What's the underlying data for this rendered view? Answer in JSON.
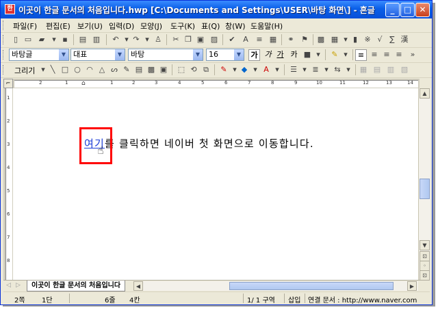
{
  "window": {
    "title": "이곳이 한글 문서의 처음입니다.hwp [C:\\Documents and Settings\\USER\\바탕 화면\\] - 흔글",
    "app_icon": "hwp-app-icon",
    "minimize": "_",
    "maximize": "□",
    "close": "✕"
  },
  "menu": [
    "파일(F)",
    "편집(E)",
    "보기(U)",
    "입력(D)",
    "모양(J)",
    "도구(K)",
    "표(Q)",
    "창(W)",
    "도움말(H)"
  ],
  "format": {
    "style": "바탕글",
    "lang": "대표",
    "font": "바탕",
    "size": "16",
    "bold": "가",
    "italic": "가",
    "underline": "가",
    "strike": "카"
  },
  "drawing": {
    "label": "그리기"
  },
  "ruler": {
    "marks": [
      "2",
      "1",
      "1",
      "2",
      "3",
      "4",
      "5",
      "6",
      "7",
      "8",
      "9",
      "10",
      "11",
      "12",
      "13",
      "14"
    ]
  },
  "vruler": {
    "marks": [
      "1",
      "2",
      "3",
      "4",
      "5",
      "6",
      "7",
      "8"
    ]
  },
  "document": {
    "link_text": "여기",
    "body_text": "를 클릭하면 네이버 첫 화면으로 이동합니다."
  },
  "tabs": {
    "active": "이곳이 한글 문서의 처음입니다"
  },
  "status": {
    "page": "2쪽",
    "column": "1단",
    "line": "6줄",
    "col": "4칸",
    "section": "1/  1 구역",
    "mode": "삽입",
    "link": "연결 문서 : http://www.naver.com"
  }
}
